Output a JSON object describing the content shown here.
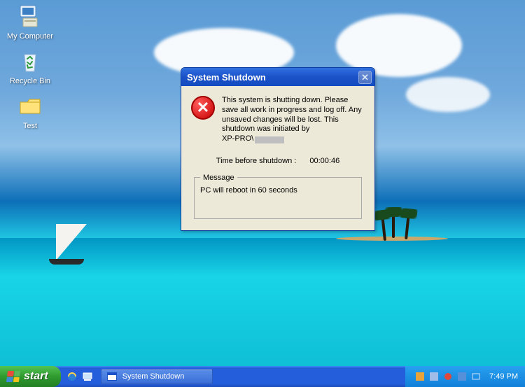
{
  "desktop": {
    "icons": [
      {
        "label": "My Computer",
        "name": "my-computer"
      },
      {
        "label": "Recycle Bin",
        "name": "recycle-bin"
      },
      {
        "label": "Test",
        "name": "folder-test"
      }
    ]
  },
  "dialog": {
    "title": "System Shutdown",
    "body_text": "This system is shutting down. Please save all work in progress and log off. Any unsaved changes will be lost. This shutdown was initiated by",
    "initiator_prefix": "XP-PRO\\",
    "initiator_redacted": true,
    "timer_label": "Time before shutdown :",
    "timer_value": "00:00:46",
    "message_legend": "Message",
    "message_text": "PC will reboot in 60 seconds"
  },
  "taskbar": {
    "start_label": "start",
    "task_buttons": [
      {
        "label": "System Shutdown"
      }
    ],
    "clock": "7:49 PM"
  }
}
